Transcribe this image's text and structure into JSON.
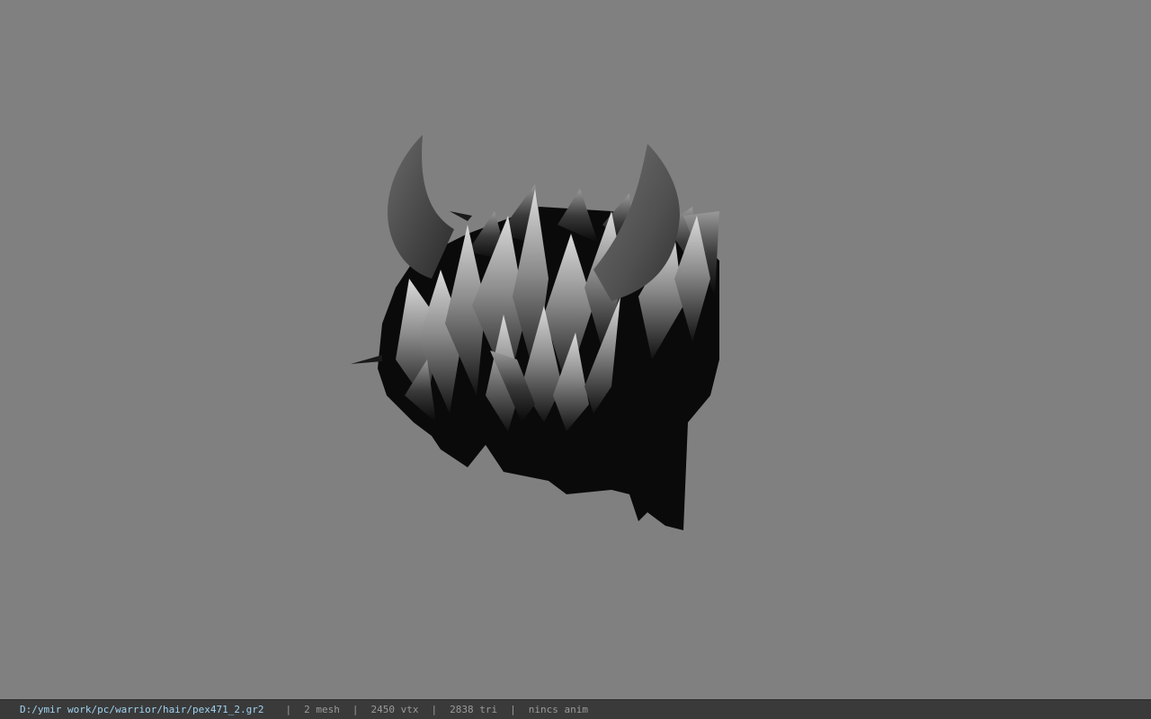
{
  "viewer": {
    "background_color": "#808080",
    "model": {
      "name": "hair-with-horns-model",
      "description_icon": "model-render"
    }
  },
  "status_bar": {
    "file_path": "D:/ymir work/pc/warrior/hair/pex471_2.gr2",
    "separator": "|",
    "mesh_count": "2 mesh",
    "vertex_count": "2450 vtx",
    "triangle_count": "2838 tri",
    "animation": "nincs anim",
    "path_color": "#9fd3f0",
    "text_color": "#9a9a9a"
  }
}
